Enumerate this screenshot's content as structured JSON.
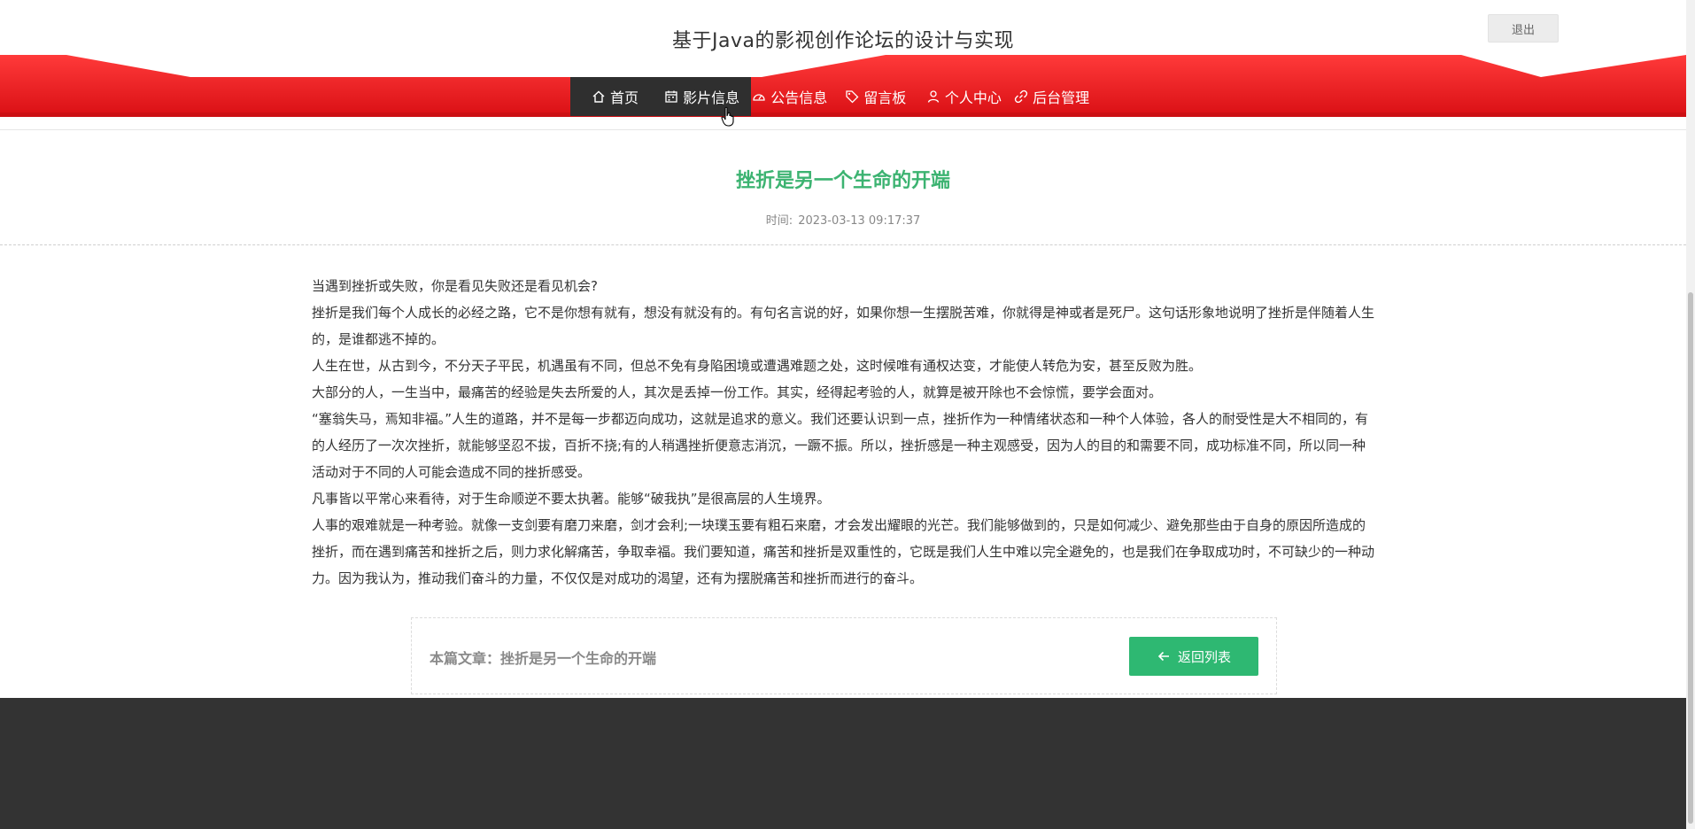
{
  "header": {
    "site_title": "基于Java的影视创作论坛的设计与实现",
    "logout_label": "退出"
  },
  "nav": {
    "items": [
      {
        "label": "首页",
        "icon": "home-icon"
      },
      {
        "label": "影片信息",
        "icon": "calendar-icon"
      },
      {
        "label": "公告信息",
        "icon": "dashboard-icon"
      },
      {
        "label": "留言板",
        "icon": "tag-icon"
      },
      {
        "label": "个人中心",
        "icon": "user-icon"
      },
      {
        "label": "后台管理",
        "icon": "link-icon"
      }
    ]
  },
  "article": {
    "title": "挫折是另一个生命的开端",
    "time_label": "时间:",
    "time_value": "2023-03-13 09:17:37",
    "paragraphs": [
      "当遇到挫折或失败，你是看见失败还是看见机会?",
      "挫折是我们每个人成长的必经之路，它不是你想有就有，想没有就没有的。有句名言说的好，如果你想一生摆脱苦难，你就得是神或者是死尸。这句话形象地说明了挫折是伴随着人生的，是谁都逃不掉的。",
      "人生在世，从古到今，不分天子平民，机遇虽有不同，但总不免有身陷困境或遭遇难题之处，这时候唯有通权达变，才能使人转危为安，甚至反败为胜。",
      "大部分的人，一生当中，最痛苦的经验是失去所爱的人，其次是丢掉一份工作。其实，经得起考验的人，就算是被开除也不会惊慌，要学会面对。",
      "“塞翁失马，焉知非福。”人生的道路，并不是每一步都迈向成功，这就是追求的意义。我们还要认识到一点，挫折作为一种情绪状态和一种个人体验，各人的耐受性是大不相同的，有的人经历了一次次挫折，就能够坚忍不拔，百折不挠;有的人稍遇挫折便意志消沉，一蹶不振。所以，挫折感是一种主观感受，因为人的目的和需要不同，成功标准不同，所以同一种活动对于不同的人可能会造成不同的挫折感受。",
      "凡事皆以平常心来看待，对于生命顺逆不要太执著。能够“破我执”是很高层的人生境界。",
      "人事的艰难就是一种考验。就像一支剑要有磨刀来磨，剑才会利;一块璞玉要有粗石来磨，才会发出耀眼的光芒。我们能够做到的，只是如何减少、避免那些由于自身的原因所造成的挫折，而在遇到痛苦和挫折之后，则力求化解痛苦，争取幸福。我们要知道，痛苦和挫折是双重性的，它既是我们人生中难以完全避免的，也是我们在争取成功时，不可缺少的一种动力。因为我认为，推动我们奋斗的力量，不仅仅是对成功的渴望，还有为摆脱痛苦和挫折而进行的奋斗。"
    ]
  },
  "footer_box": {
    "current_label": "本篇文章：挫折是另一个生命的开端",
    "return_label": "返回列表"
  },
  "colors": {
    "accent_red": "#e8151b",
    "title_green": "#3cb371",
    "button_green": "#2eb872",
    "footer_dark": "#333333"
  }
}
